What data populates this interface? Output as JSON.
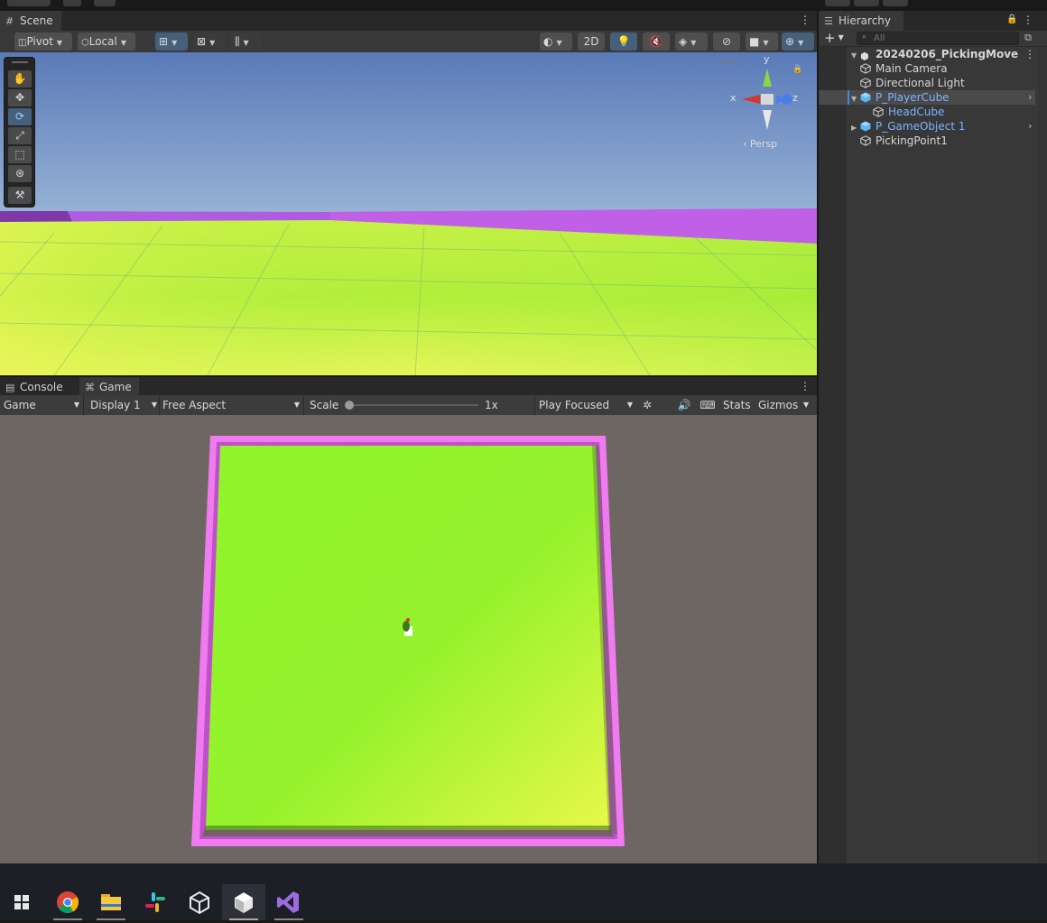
{
  "scene_panel": {
    "tab_label": "Scene",
    "toolbar": {
      "pivot_label": "Pivot",
      "local_label": "Local",
      "mode_2d_label": "2D"
    },
    "gizmo": {
      "axis_x": "x",
      "axis_y": "y",
      "axis_z": "z",
      "projection_label": "‹ Persp"
    }
  },
  "game_panel": {
    "tabs": [
      {
        "label": "Console",
        "icon": "console-icon",
        "active": false
      },
      {
        "label": "Game",
        "icon": "gamepad-icon",
        "active": true
      }
    ],
    "toolbar": {
      "game_select": "Game",
      "display_select": "Display 1",
      "aspect_select": "Free Aspect",
      "scale_label": "Scale",
      "scale_value_label": "1x",
      "scale_value": 0.0,
      "play_mode_select": "Play Focused",
      "stats_label": "Stats",
      "gizmos_label": "Gizmos"
    }
  },
  "hierarchy": {
    "tab_label": "Hierarchy",
    "search_placeholder": "All",
    "scene_name": "20240206_PickingMove",
    "items": [
      {
        "label": "Main Camera",
        "depth": 1,
        "prefab": false,
        "expander": "none"
      },
      {
        "label": "Directional Light",
        "depth": 1,
        "prefab": false,
        "expander": "none"
      },
      {
        "label": "P_PlayerCube",
        "depth": 1,
        "prefab": true,
        "expander": "expanded",
        "selected": true
      },
      {
        "label": "HeadCube",
        "depth": 2,
        "prefab": false,
        "expander": "none",
        "blue": true
      },
      {
        "label": "P_GameObject 1",
        "depth": 1,
        "prefab": true,
        "expander": "collapsed"
      },
      {
        "label": "PickingPoint1",
        "depth": 1,
        "prefab": false,
        "expander": "none"
      }
    ]
  },
  "taskbar": {
    "apps": [
      "windows-start",
      "chrome",
      "file-explorer",
      "slack",
      "unity-hub",
      "unity-editor",
      "visual-studio"
    ],
    "active_app": "unity-editor"
  },
  "colors": {
    "accent_blue": "#46607c",
    "prefab_blue": "#7cb4ff",
    "ground_green": "#8ff52a",
    "wall_pink": "#f07af0"
  }
}
